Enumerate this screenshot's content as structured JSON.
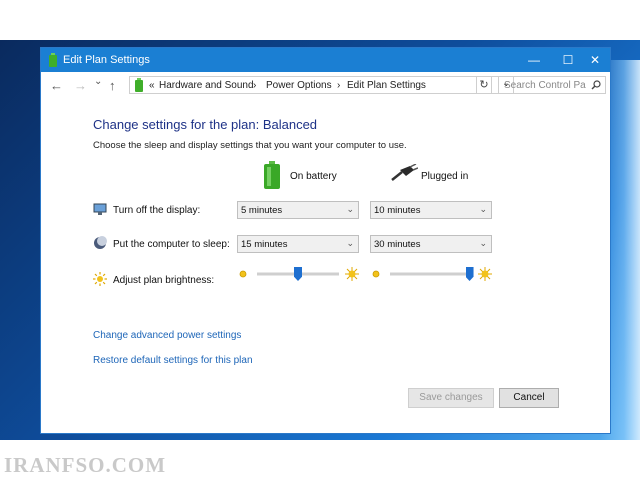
{
  "window": {
    "title": "Edit Plan Settings",
    "min_icon": "—",
    "max_icon": "☐",
    "close_icon": "✕"
  },
  "address": {
    "back_icon": "←",
    "forward_icon": "→",
    "recent_icon": "⌄",
    "up_icon": "↑",
    "overflow": "«",
    "crumbs": [
      "Hardware and Sound",
      "Power Options",
      "Edit Plan Settings"
    ],
    "separator": "›",
    "dropdown_icon": "⌄",
    "refresh_icon": "↻",
    "search_placeholder": "Search Control Pa..."
  },
  "heading": "Change settings for the plan: Balanced",
  "description": "Choose the sleep and display settings that you want your computer to use.",
  "columns": {
    "battery": "On battery",
    "plugged": "Plugged in"
  },
  "rows": {
    "display": {
      "label": "Turn off the display:",
      "battery": "5 minutes",
      "plugged": "10 minutes"
    },
    "sleep": {
      "label": "Put the computer to sleep:",
      "battery": "15 minutes",
      "plugged": "30 minutes"
    },
    "brightness": {
      "label": "Adjust plan brightness:",
      "battery_level": 0.5,
      "plugged_level": 0.97
    }
  },
  "dropdown_arrow": "⌄",
  "links": {
    "advanced": "Change advanced power settings",
    "restore": "Restore default settings for this plan"
  },
  "buttons": {
    "save": "Save changes",
    "cancel": "Cancel"
  },
  "watermark": "IRANFSO.COM",
  "colors": {
    "titlebar": "#1b7fd3",
    "heading": "#1e3287",
    "link": "#1e66b8",
    "slider_thumb": "#1e6fd0"
  }
}
